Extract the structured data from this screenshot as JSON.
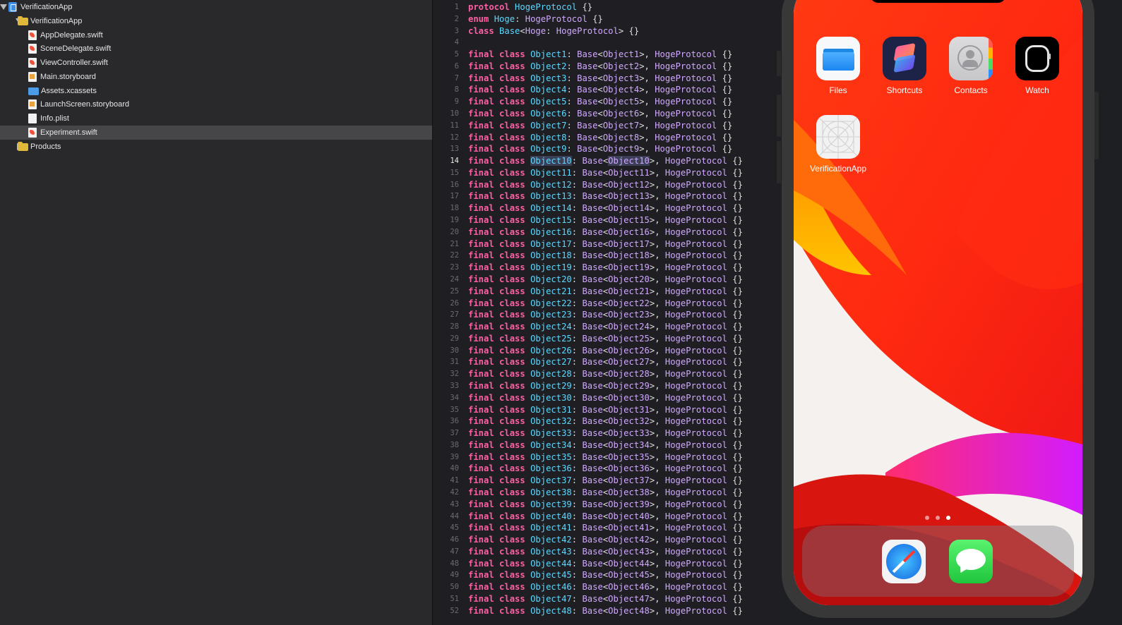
{
  "navigator": {
    "items": [
      {
        "label": "VerificationApp",
        "kind": "proj",
        "indent": 0,
        "disclosure": "open"
      },
      {
        "label": "VerificationApp",
        "kind": "folder",
        "indent": 1,
        "disclosure": "open"
      },
      {
        "label": "AppDelegate.swift",
        "kind": "swift",
        "indent": 2
      },
      {
        "label": "SceneDelegate.swift",
        "kind": "swift",
        "indent": 2
      },
      {
        "label": "ViewController.swift",
        "kind": "swift",
        "indent": 2
      },
      {
        "label": "Main.storyboard",
        "kind": "sb",
        "indent": 2
      },
      {
        "label": "Assets.xcassets",
        "kind": "assets",
        "indent": 2
      },
      {
        "label": "LaunchScreen.storyboard",
        "kind": "sb",
        "indent": 2
      },
      {
        "label": "Info.plist",
        "kind": "doc",
        "indent": 2
      },
      {
        "label": "Experiment.swift",
        "kind": "swift",
        "indent": 2,
        "selected": true
      },
      {
        "label": "Products",
        "kind": "folder",
        "indent": 1,
        "disclosure": "closed"
      }
    ]
  },
  "editor": {
    "current_line": 14,
    "header_lines": [
      "protocol HogeProtocol {}",
      "enum Hoge: HogeProtocol {}",
      "class Base<Hoge: HogeProtocol> {}",
      ""
    ],
    "class_prefix": "final class",
    "class_template": "Object{n}: Base<Object{n}>, HogeProtocol {}",
    "class_count": 48,
    "highlighted_symbol": "Object10",
    "colors": {
      "keyword": "#fc5fa3",
      "type": "#5dd8ff",
      "other_type": "#d0a8ff"
    }
  },
  "simulator": {
    "apps": [
      {
        "label": "Files",
        "icon": "folder-icon"
      },
      {
        "label": "Shortcuts",
        "icon": "shortcuts-icon"
      },
      {
        "label": "Contacts",
        "icon": "contacts-icon"
      },
      {
        "label": "Watch",
        "icon": "watch-icon"
      },
      {
        "label": "VerificationApp",
        "icon": "blank-app-icon"
      }
    ],
    "dock_apps": [
      {
        "label": "Safari",
        "icon": "safari-icon"
      },
      {
        "label": "Messages",
        "icon": "messages-icon"
      }
    ],
    "page_count": 3,
    "current_page": 3
  }
}
